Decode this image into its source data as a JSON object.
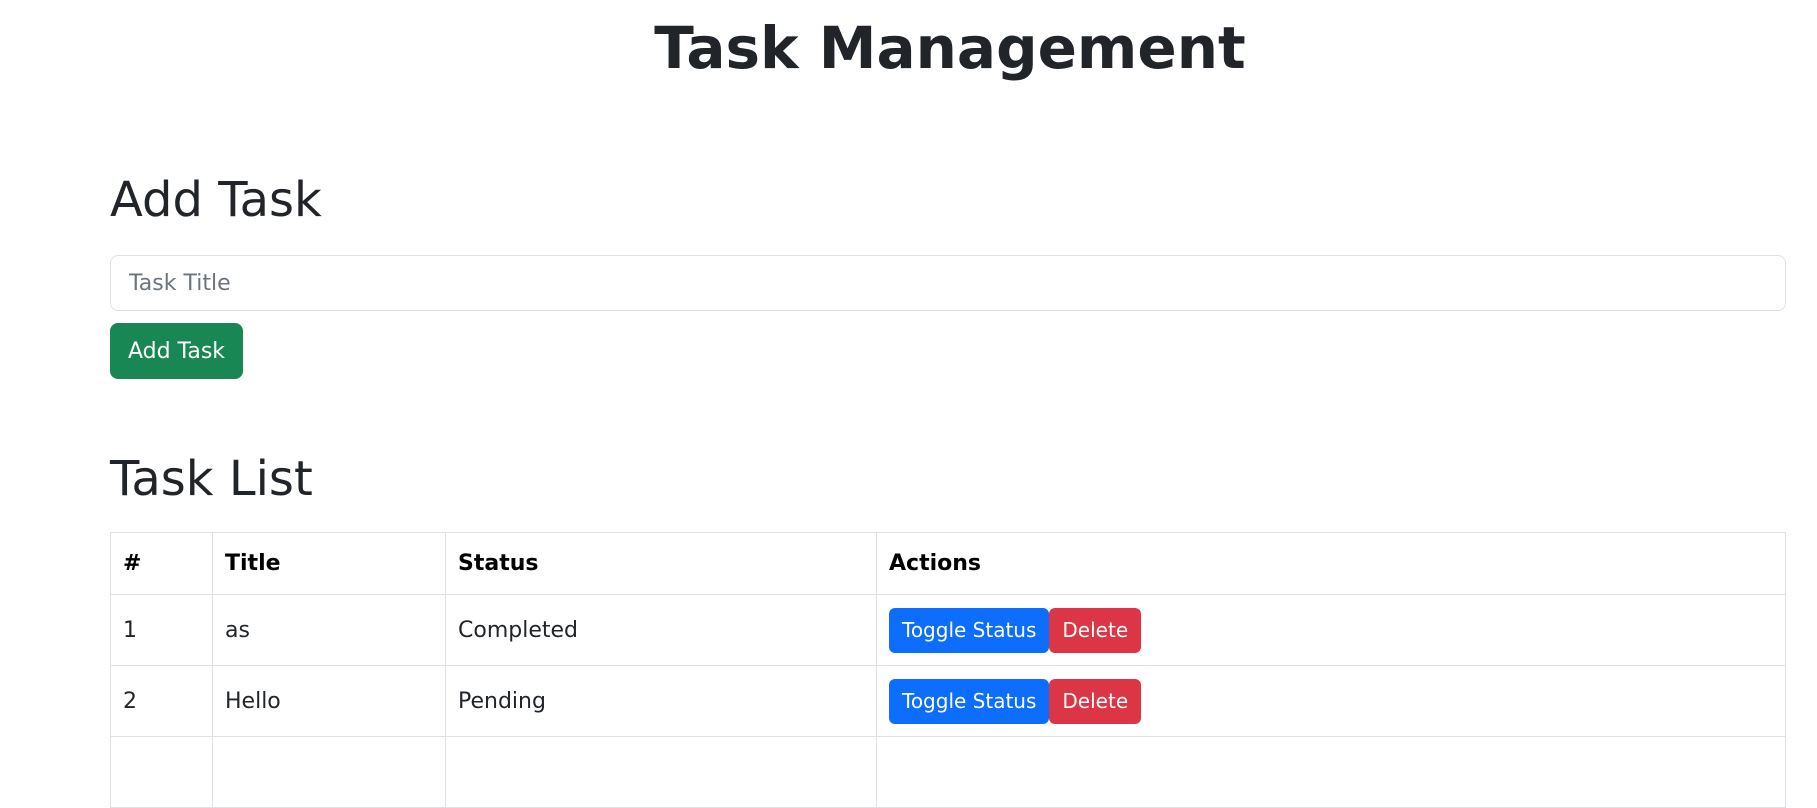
{
  "header": {
    "title": "Task Management"
  },
  "add_task": {
    "heading": "Add Task",
    "input_placeholder": "Task Title",
    "input_value": "",
    "button_label": "Add Task"
  },
  "task_list": {
    "heading": "Task List",
    "columns": [
      "#",
      "Title",
      "Status",
      "Actions"
    ],
    "rows": [
      {
        "num": "1",
        "title": "as",
        "status": "Completed",
        "toggle_label": "Toggle Status",
        "delete_label": "Delete"
      },
      {
        "num": "2",
        "title": "Hello",
        "status": "Pending",
        "toggle_label": "Toggle Status",
        "delete_label": "Delete"
      }
    ]
  },
  "colors": {
    "success": "#198754",
    "primary": "#0d6efd",
    "danger": "#dc3545",
    "text": "#212529",
    "border": "#dee2e6"
  }
}
